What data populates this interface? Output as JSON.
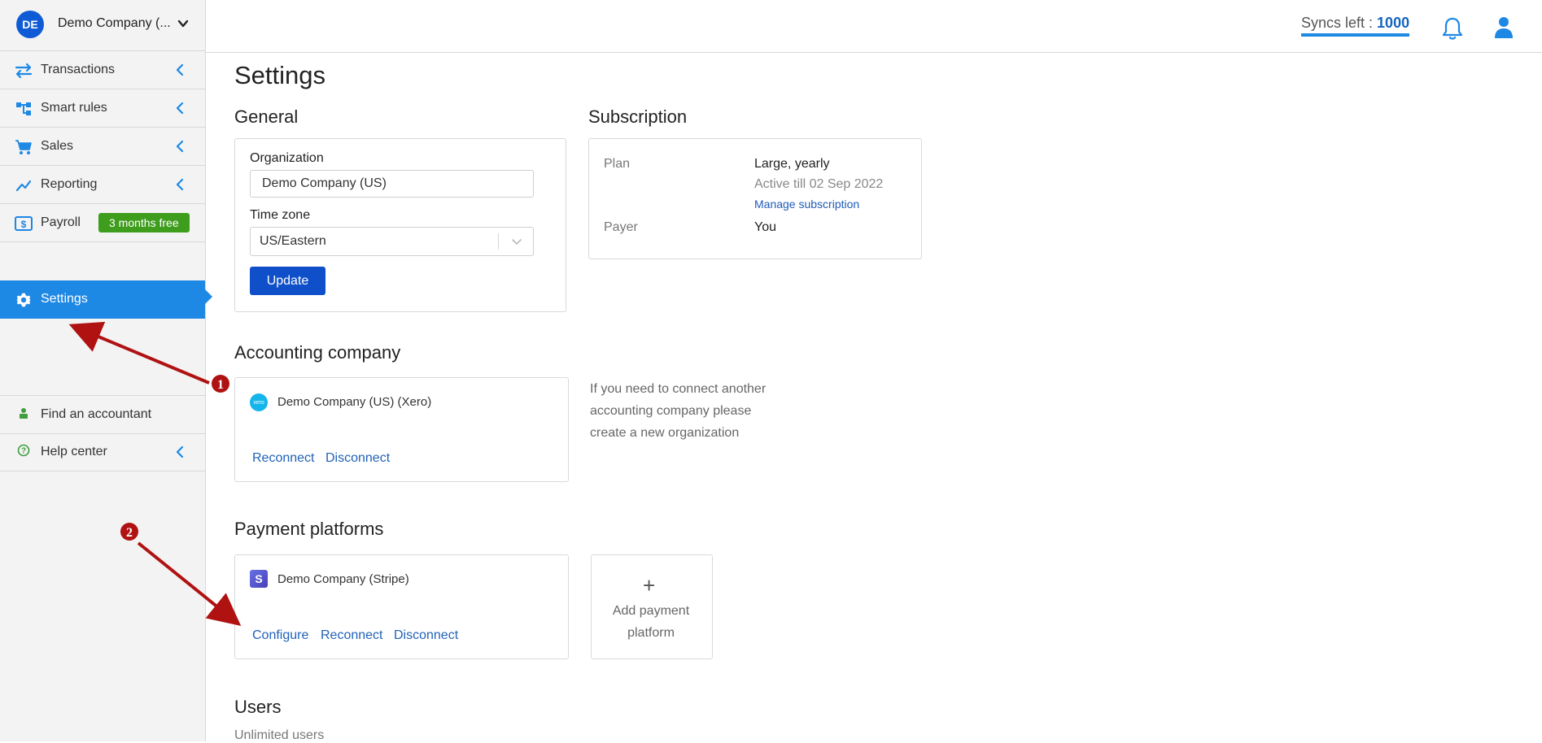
{
  "sidebar": {
    "company": {
      "initials": "DE",
      "name": "Demo Company (..."
    },
    "items": [
      {
        "label": "Transactions",
        "icon": "transfer-arrows-icon"
      },
      {
        "label": "Smart rules",
        "icon": "sitemap-icon"
      },
      {
        "label": "Sales",
        "icon": "cart-icon"
      },
      {
        "label": "Reporting",
        "icon": "trend-line-icon"
      },
      {
        "label": "Payroll",
        "icon": "dollar-card-icon",
        "badge": "3 months free"
      },
      {
        "label": "Settings",
        "icon": "gear-icon",
        "active": true
      },
      {
        "label": "Find an accountant",
        "icon": "person-icon"
      },
      {
        "label": "Help center",
        "icon": "question-circle-icon"
      }
    ]
  },
  "topbar": {
    "syncs_label": "Syncs left :",
    "syncs_value": "1000"
  },
  "main": {
    "title": "Settings",
    "general": {
      "heading": "General",
      "org_label": "Organization",
      "org_value": "Demo Company (US)",
      "tz_label": "Time zone",
      "tz_value": "US/Eastern",
      "update_label": "Update"
    },
    "subscription": {
      "heading": "Subscription",
      "plan_label": "Plan",
      "plan_value": "Large, yearly",
      "plan_active": "Active till 02 Sep 2022",
      "manage_link": "Manage subscription",
      "payer_label": "Payer",
      "payer_value": "You"
    },
    "accounting": {
      "heading": "Accounting company",
      "company": "Demo Company (US) (Xero)",
      "logo_text": "xero",
      "reconnect": "Reconnect",
      "disconnect": "Disconnect",
      "note": "If you need to connect another accounting company please create a new organization"
    },
    "payments": {
      "heading": "Payment platforms",
      "company": "Demo Company (Stripe)",
      "logo_text": "S",
      "configure": "Configure",
      "reconnect": "Reconnect",
      "disconnect": "Disconnect",
      "add_plus": "+",
      "add_label": "Add payment platform"
    },
    "users": {
      "heading": "Users",
      "sub": "Unlimited users"
    }
  },
  "annotations": {
    "marker1": "1",
    "marker2": "2",
    "arrow_color": "#b01212"
  },
  "colors": {
    "accent": "#1e88e5",
    "primary_button": "#0f4fc9",
    "promo_badge": "#3f9d1e"
  }
}
